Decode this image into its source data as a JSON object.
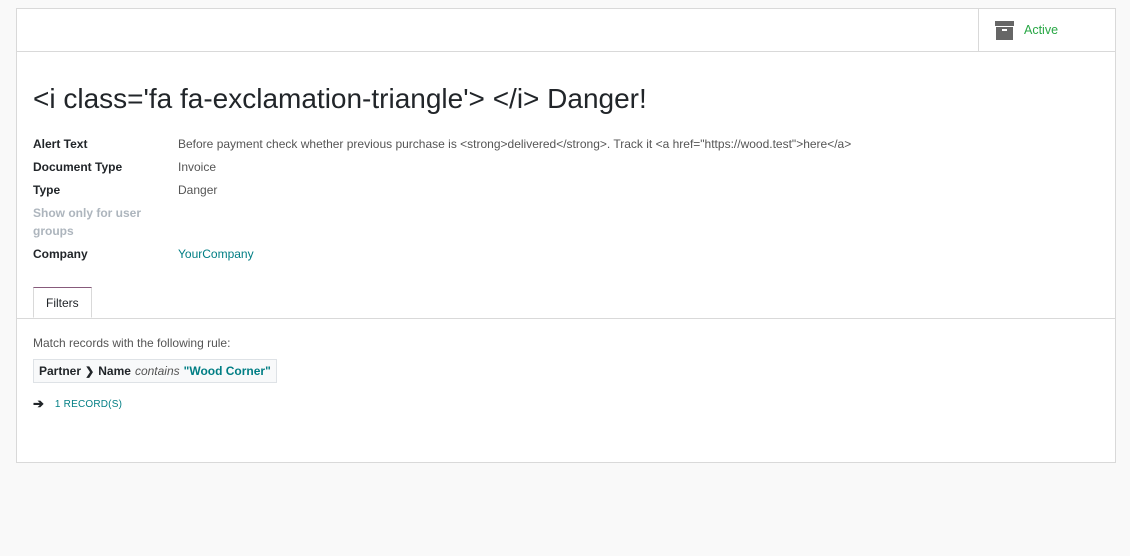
{
  "button_box": {
    "active_label": "Active",
    "icon": "archive-icon"
  },
  "title": "<i class='fa fa-exclamation-triangle'> </i> Danger!",
  "fields": {
    "alert_text": {
      "label": "Alert Text",
      "value": "Before payment check whether previous purchase is <strong>delivered</strong>. Track it <a href=\"https://wood.test\">here</a>"
    },
    "document_type": {
      "label": "Document Type",
      "value": "Invoice"
    },
    "type": {
      "label": "Type",
      "value": "Danger"
    },
    "user_groups": {
      "label": "Show only for user groups",
      "value": ""
    },
    "company": {
      "label": "Company",
      "value": "YourCompany"
    }
  },
  "tabs": [
    {
      "label": "Filters",
      "active": true
    }
  ],
  "filters": {
    "rule_text": "Match records with the following rule:",
    "domain": {
      "path_start": "Partner",
      "separator": "❯",
      "path_end": "Name",
      "operator": "contains",
      "value": "\"Wood Corner\""
    },
    "records_label": "1 RECORD(S)",
    "arrow_icon": "arrow-right-icon"
  },
  "colors": {
    "active": "#28a745",
    "link": "#017e84",
    "tab_accent": "#875a7b"
  }
}
